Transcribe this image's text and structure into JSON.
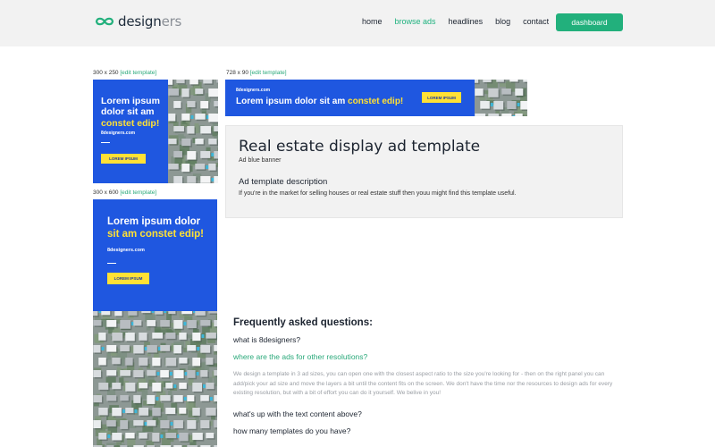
{
  "brand": {
    "name_dark": "design",
    "name_light": "ers",
    "accent": "#22b07c"
  },
  "nav": {
    "items": [
      {
        "label": "home",
        "active": false
      },
      {
        "label": "browse ads",
        "active": true
      },
      {
        "label": "headlines",
        "active": false
      },
      {
        "label": "blog",
        "active": false
      },
      {
        "label": "contact",
        "active": false
      }
    ],
    "dashboard_label": "dashboard"
  },
  "ads": {
    "edit_label": "[edit template]",
    "ad_300x250": {
      "size": "300 x 250",
      "headline_a": "Lorem ipsum dolor sit am ",
      "headline_b": "constet edip!",
      "site": "8designers.com",
      "cta": "LOREM IPSUM"
    },
    "ad_728x90": {
      "size": "728 x 90",
      "site": "8designers.com",
      "headline_a": "Lorem ipsum dolor sit am ",
      "headline_b": "constet edip!",
      "cta": "LOREM IPSUM"
    },
    "ad_300x600": {
      "size": "300 x 600",
      "headline_a": "Lorem ipsum dolor ",
      "headline_b": "sit am constet edip!",
      "site": "8designers.com",
      "cta": "LOREM IPSUM"
    },
    "colors": {
      "blue": "#1f57e0",
      "yellow": "#ffe135"
    }
  },
  "template": {
    "title": "Real estate display ad template",
    "subtitle": "Ad blue banner",
    "desc_heading": "Ad template description",
    "description": "If you're in the market for selling houses or real estate stuff then youu might find this template useful."
  },
  "faq": {
    "title": "Frequently asked questions:",
    "q1": "what is 8designers?",
    "q2": "where are the ads for other resolutions?",
    "a2": "We design a template in 3 ad sizes, you can open one with the closest aspect ratio to the size you're looking for - then on the right panel you can add/pick your ad size and move the layers a bit until the content fits on the screen. We don't have the time nor the resources to design ads for every existing resolution, but with a bit of effort you can do it yourself. We belive in you!",
    "q3": "what's up with the text content above?",
    "q4": "how many templates do you have?"
  }
}
